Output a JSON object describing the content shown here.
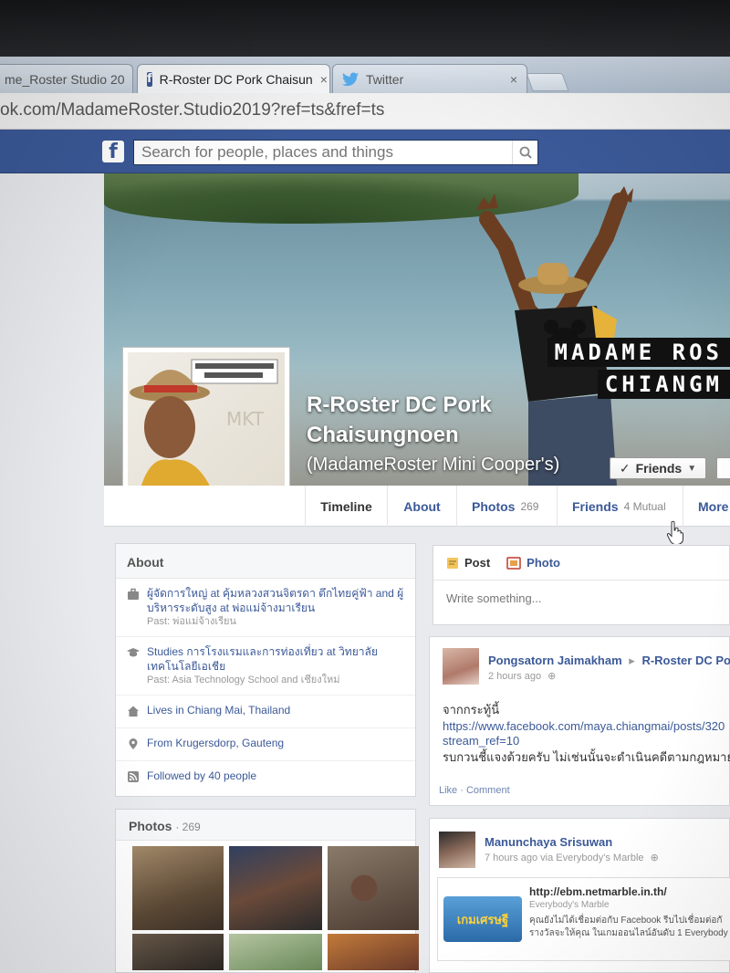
{
  "browser": {
    "tabs": [
      {
        "label": "me_Roster Studio 20",
        "close": "×",
        "active": false
      },
      {
        "label": "R-Roster DC Pork Chaisun",
        "close": "×",
        "active": true
      },
      {
        "label": "Twitter",
        "close": "×",
        "active": false
      }
    ],
    "url": "ok.com/MadameRoster.Studio2019?ref=ts&fref=ts"
  },
  "fbbar": {
    "logo": "f",
    "search_placeholder": "Search for people, places and things"
  },
  "cover": {
    "overlay_line1": "MADAME ROS",
    "overlay_line2": "CHIANGM"
  },
  "profile": {
    "name_line1": "R-Roster DC Pork",
    "name_line2": "Chaisungnoen",
    "alternate_name": "(MadameRoster Mini Cooper's)",
    "friends_button": "Friends"
  },
  "nav": {
    "timeline": "Timeline",
    "about": "About",
    "photos": "Photos",
    "photos_count": "269",
    "friends": "Friends",
    "friends_mutual": "4 Mutual",
    "more": "More"
  },
  "about": {
    "title": "About",
    "items": [
      {
        "text": "ผู้จัดการใหญ่ at คุ้มหลวงสวนจิตรดา ตึกไทยคู่ฟ้า and ผู้บริหารระดับสูง at พ่อแม่จ้างมาเรียน",
        "sub": "Past: พ่อแม่จ้างเรียน"
      },
      {
        "text": "Studies การโรงแรมและการท่องเที่ยว at วิทยาลัยเทคโนโลยีเอเชีย",
        "sub": "Past: Asia Technology School and เชียงใหม่"
      },
      {
        "text": "Lives in Chiang Mai, Thailand",
        "sub": ""
      },
      {
        "text": "From Krugersdorp, Gauteng",
        "sub": ""
      },
      {
        "text": "Followed by 40 people",
        "sub": ""
      }
    ]
  },
  "photos": {
    "title": "Photos",
    "count": "· 269"
  },
  "composer": {
    "post": "Post",
    "photo": "Photo",
    "placeholder": "Write something..."
  },
  "stories": [
    {
      "author": "Pongsatorn Jaimakham",
      "arrow": "▸",
      "target": "R-Roster DC Po",
      "time": "2 hours ago",
      "line1": "จากกระทู้นี้",
      "line2": "https://www.facebook.com/maya.chiangmai/posts/320",
      "line3": "stream_ref=10",
      "line4": "รบกวนชี้แจงด้วยครับ ไม่เช่นนั้นจะดำเนินคดีตามกฎหมายเพื่อ",
      "actions": "Like · Comment"
    },
    {
      "author": "Manunchaya Srisuwan",
      "time": "7 hours ago via Everybody's Marble",
      "link_url": "http://ebm.netmarble.in.th/",
      "link_source": "Everybody's Marble",
      "link_desc1": "คุณยังไม่ได้เชื่อมต่อกับ Facebook รีบไปเชื่อมต่อกั",
      "link_desc2": "รางวัลจะให้คุณ ในเกมออนไลน์อันดับ 1 Everybody",
      "logo_text": "เกมเศรษฐี"
    }
  ],
  "colors": {
    "fb_blue": "#3b5998",
    "link": "#3b5998",
    "page_bg": "#e9eaed"
  }
}
